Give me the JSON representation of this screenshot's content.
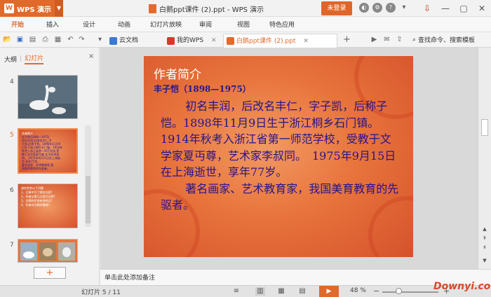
{
  "app": {
    "name": "WPS 演示",
    "doc_title": "白鹅ppt课件 (2).ppt - WPS 演示",
    "login": "未登录"
  },
  "menu": [
    "开始",
    "插入",
    "设计",
    "动画",
    "幻灯片放映",
    "审阅",
    "视图",
    "特色应用"
  ],
  "tabs": {
    "cloud": "云文档",
    "mywps": "我的WPS",
    "doc": "白鹅ppt课件 (2).ppt",
    "add": "+"
  },
  "search": {
    "label": "查找命令、搜索模板"
  },
  "panel": {
    "outline": "大纲",
    "slides": "幻灯片",
    "close": "×",
    "add": "+"
  },
  "thumbs": [
    {
      "num": "4"
    },
    {
      "num": "5",
      "lines": [
        "作者简介",
        "丰子恺(1898—1975)",
        "初名丰润,后改名丰仁,字",
        "子凯,后称子恺。1898年11月9",
        "日生于浙江桐乡石门镇。1914年",
        "秋考入浙江省第一师范学校,受",
        "教于文学家夏丏尊,艺术家李叔",
        "同。 1975年9月15日在上海逝",
        "世,享年77岁。",
        "著名画家、艺术教育家,我",
        "国美育教育的先驱者。"
      ]
    },
    {
      "num": "6",
      "lines": [
        "请你思考以下问题",
        "1、文章中写了哪些内容?",
        "2、作者从哪几方面写白鹅?",
        "3、白鹅的步态有何特点?",
        "4、作者对白鹅的情感?"
      ]
    },
    {
      "num": "7"
    }
  ],
  "slide": {
    "heading": "作者简介",
    "subtitle": "丰子恺（1898—1975）",
    "para1": "初名丰润，后改名丰仁，字子凯，后称子恺。1898年11月9日生于浙江桐乡石门镇。1914年秋考入浙江省第一师范学校，受教于文学家夏丏尊，艺术家李叔同。　1975年9月15日在上海逝世，享年77岁。",
    "para2": "著名画家、艺术教育家，我国美育教育的先驱者。"
  },
  "notes": "单击此处添加备注",
  "status": {
    "slide_count": "幻灯片 5 / 11",
    "zoom": "48 %"
  },
  "watermark": "Downyi.com",
  "colors": {
    "accent": "#e06a2c",
    "slide_text": "#27138a"
  }
}
